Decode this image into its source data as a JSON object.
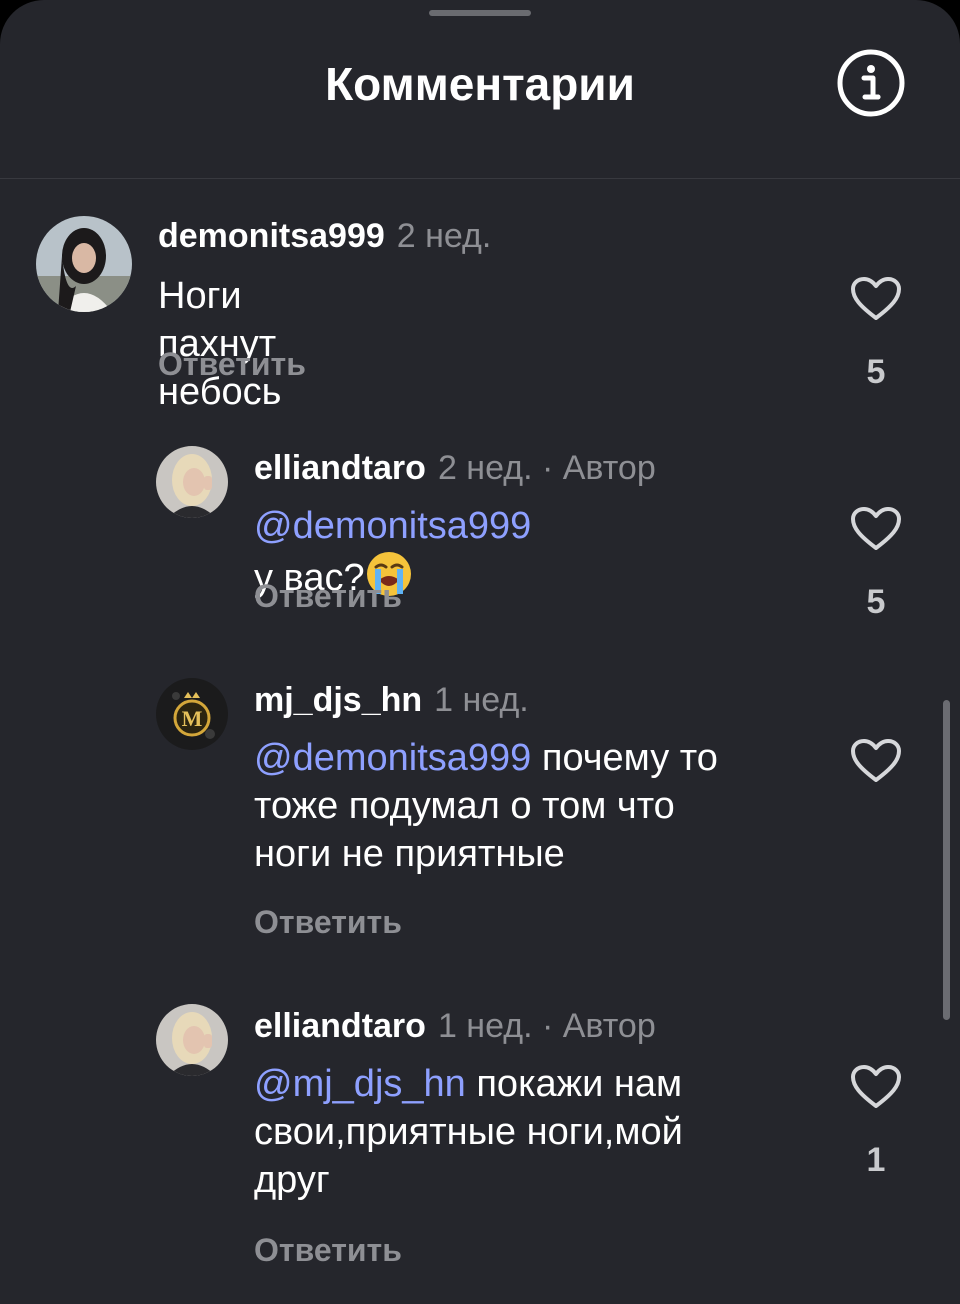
{
  "header": {
    "title": "Комментарии",
    "info_icon": "info-circle-icon"
  },
  "comments": [
    {
      "username": "demonitsa999",
      "time": "2 нед.",
      "author_tag": "",
      "mention": "",
      "text": "Ноги пахнут небось",
      "reply_label": "Ответить",
      "likes": "5"
    },
    {
      "username": "elliandtaro",
      "time": "2 нед.",
      "author_tag": " · Автор",
      "mention": "@demonitsa999",
      "text": " у вас?",
      "emoji": "loudly-crying-face-emoji",
      "reply_label": "Ответить",
      "likes": "5"
    },
    {
      "username": "mj_djs_hn",
      "time": "1 нед.",
      "author_tag": "",
      "mention": "@demonitsa999",
      "text_lines": [
        " почему то",
        "тоже подумал о том что",
        "ноги не приятные"
      ],
      "reply_label": "Ответить",
      "likes": ""
    },
    {
      "username": "elliandtaro",
      "time": "1 нед.",
      "author_tag": " · Автор",
      "mention": "@mj_djs_hn",
      "text_lines": [
        " покажи нам",
        "свои,приятные ноги,мой",
        "друг"
      ],
      "reply_label": "Ответить",
      "likes": "1"
    }
  ],
  "colors": {
    "background": "#25262c",
    "mention": "#8ea0ff",
    "secondary_text": "#8e8f94"
  }
}
